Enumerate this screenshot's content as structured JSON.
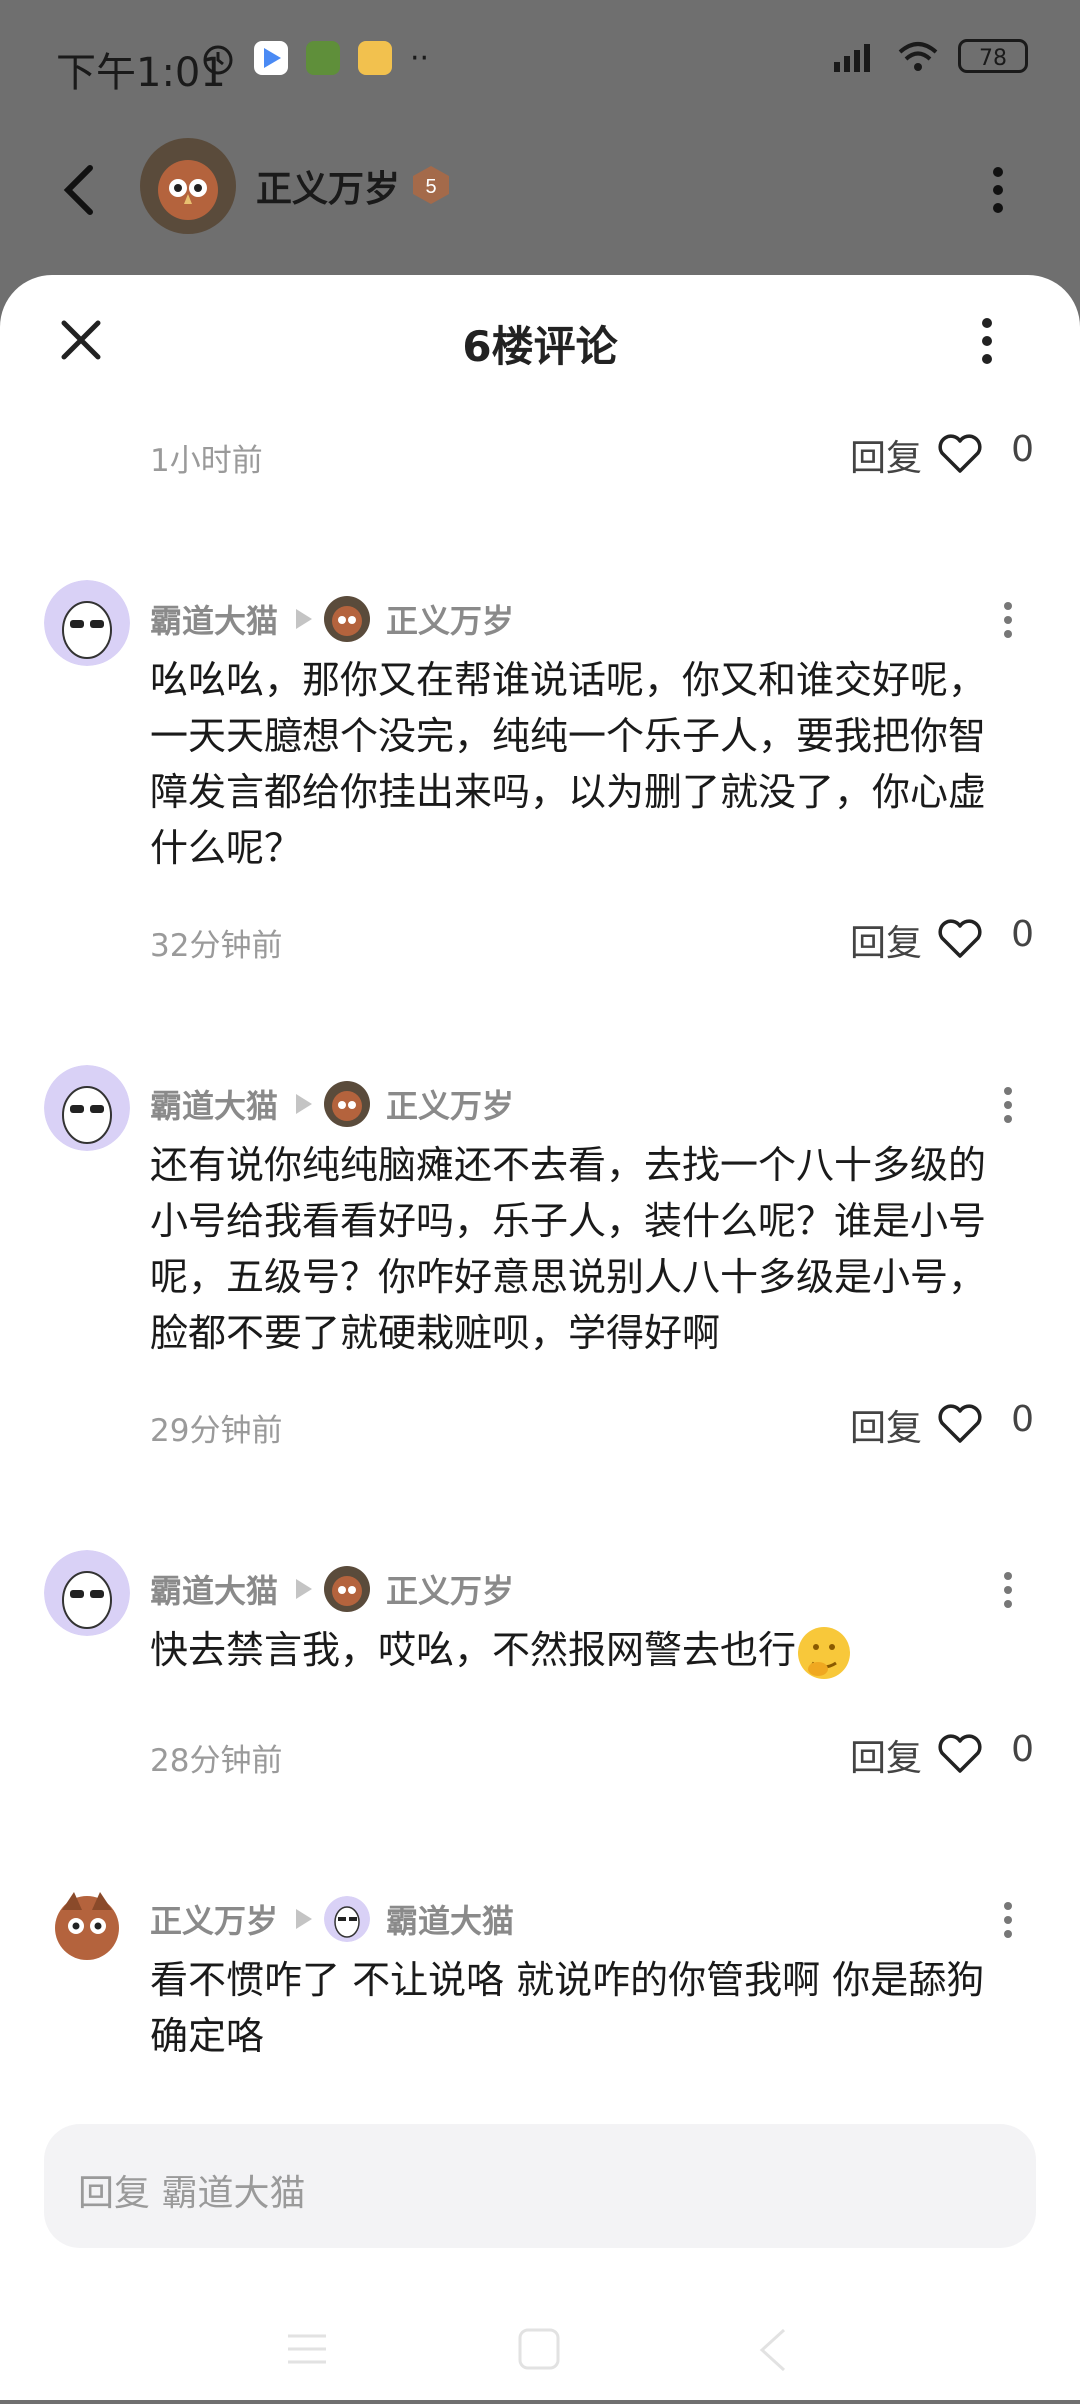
{
  "status_bar": {
    "time": "下午1:01",
    "battery": "78"
  },
  "header": {
    "name": "正义万岁",
    "level": "5"
  },
  "sheet": {
    "title": "6楼评论"
  },
  "first_meta": {
    "time": "1小时前",
    "reply": "回复",
    "likes": "0"
  },
  "comments": [
    {
      "author": "霸道大猫",
      "target": "正义万岁",
      "text": "吆吆吆，那你又在帮谁说话呢，你又和谁交好呢，一天天臆想个没完，纯纯一个乐子人，要我把你智障发言都给你挂出来吗，以为删了就没了，你心虚什么呢？",
      "time": "32分钟前",
      "reply": "回复",
      "likes": "0"
    },
    {
      "author": "霸道大猫",
      "target": "正义万岁",
      "text": "还有说你纯纯脑瘫还不去看，去找一个八十多级的小号给我看看好吗，乐子人，装什么呢？谁是小号呢，五级号？你咋好意思说别人八十多级是小号，脸都不要了就硬栽赃呗，学得好啊",
      "time": "29分钟前",
      "reply": "回复",
      "likes": "0"
    },
    {
      "author": "霸道大猫",
      "target": "正义万岁",
      "text": "快去禁言我，哎吆，不然报网警去也行",
      "time": "28分钟前",
      "reply": "回复",
      "likes": "0"
    },
    {
      "author": "正义万岁",
      "target": "霸道大猫",
      "text": "看不惯咋了 不让说咯 就说咋的你管我啊 你是舔狗确定咯"
    }
  ],
  "reply_box": {
    "placeholder": "回复 霸道大猫"
  },
  "colors": {
    "sheet_bg": "#ffffff",
    "dim_bg": "#6f6f6f",
    "input_bg": "#f3f3f5"
  }
}
